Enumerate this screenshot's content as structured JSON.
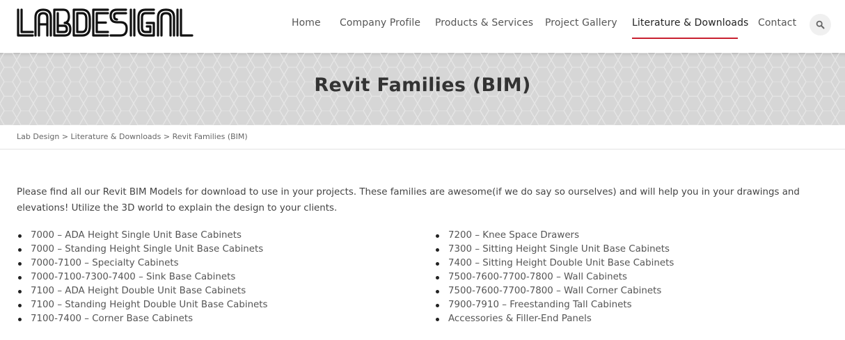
{
  "brand": {
    "logo_text": "LABDESIGN"
  },
  "nav": {
    "items": [
      {
        "label": "Home"
      },
      {
        "label": "Company Profile"
      },
      {
        "label": "Products & Services"
      },
      {
        "label": "Project Gallery"
      },
      {
        "label": "Literature & Downloads",
        "active": true
      },
      {
        "label": "Contact"
      }
    ],
    "search_icon": "search-icon",
    "accent_color": "#c8202f"
  },
  "page": {
    "title": "Revit Families (BIM)"
  },
  "breadcrumb": {
    "items": [
      "Lab Design",
      "Literature & Downloads",
      "Revit Families (BIM)"
    ],
    "separator": ">"
  },
  "content": {
    "intro": "Please find all our Revit BIM Models for download to use in your projects.  These families are awesome(if we do say so ourselves) and will help you in your drawings and elevations!  Utilize the 3D world to explain the design to your clients.",
    "left_list": [
      "7000 – ADA Height Single Unit Base Cabinets",
      "7000 – Standing Height Single Unit Base Cabinets",
      "7000-7100 – Specialty Cabinets",
      "7000-7100-7300-7400 – Sink Base Cabinets",
      "7100 – ADA Height Double Unit Base Cabinets",
      "7100 – Standing Height Double Unit Base Cabinets",
      "7100-7400 – Corner Base Cabinets"
    ],
    "right_list": [
      "7200 – Knee Space Drawers",
      "7300 – Sitting Height Single Unit Base Cabinets",
      "7400 – Sitting Height Double Unit Base Cabinets",
      "7500-7600-7700-7800 – Wall Cabinets",
      "7500-7600-7700-7800 – Wall Corner Cabinets",
      "7900-7910 – Freestanding Tall Cabinets",
      "Accessories & Filler-End Panels"
    ]
  }
}
